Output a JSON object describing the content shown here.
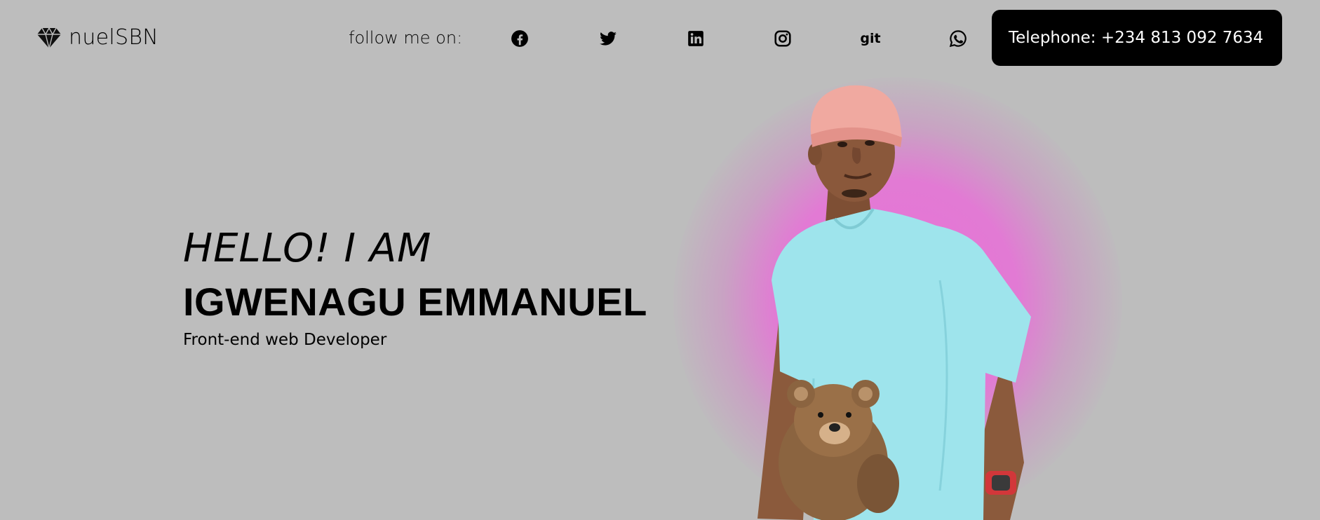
{
  "header": {
    "logo_text": "nuelSBN",
    "follow_label": "follow me on:",
    "social": [
      {
        "icon": "facebook-icon"
      },
      {
        "icon": "twitter-icon"
      },
      {
        "icon": "linkedin-icon"
      },
      {
        "icon": "instagram-icon"
      },
      {
        "label": "git"
      },
      {
        "icon": "whatsapp-icon"
      }
    ],
    "phone_label": "Telephone: +234 813 092 7634"
  },
  "hero": {
    "greeting": "HELLO! I AM",
    "name": "IGWENAGU EMMANUEL",
    "role": "Front-end web Developer"
  },
  "colors": {
    "background": "#bdbdbd",
    "glow": "#e873d8",
    "phone_bg": "#000000",
    "shirt": "#9ee4ec",
    "cap": "#f0a9a0"
  }
}
